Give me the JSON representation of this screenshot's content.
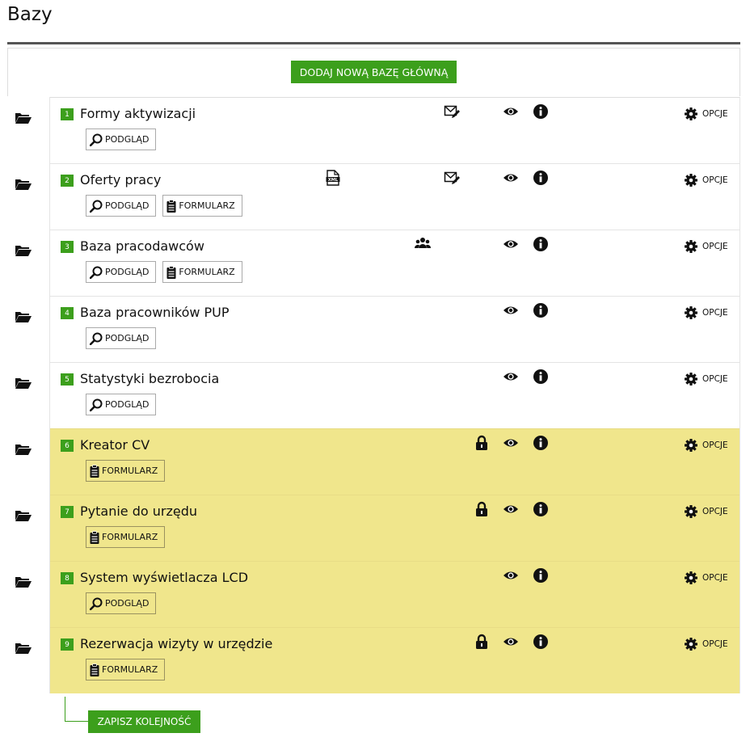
{
  "page": {
    "title": "Bazy"
  },
  "toolbar": {
    "add_label": "DODAJ NOWĄ BAZĘ GŁÓWNĄ"
  },
  "footer": {
    "save_label": "ZAPISZ KOLEJNOŚĆ"
  },
  "labels": {
    "preview": "PODGLĄD",
    "form": "FORMULARZ",
    "options": "OPCJE"
  },
  "colors": {
    "accent": "#3c9f1c",
    "highlight": "#f0e68c"
  },
  "rows": [
    {
      "number": "1",
      "name": "Formy aktywizacji",
      "highlight": false,
      "buttons": [
        "preview"
      ],
      "icons": [
        "envelope-edit-icon",
        "eye-icon",
        "info-icon"
      ]
    },
    {
      "number": "2",
      "name": "Oferty pracy",
      "highlight": false,
      "buttons": [
        "preview",
        "form"
      ],
      "icons": [
        "xml-file-icon",
        "envelope-edit-icon",
        "eye-icon",
        "info-icon"
      ]
    },
    {
      "number": "3",
      "name": "Baza pracodawców",
      "highlight": false,
      "buttons": [
        "preview",
        "form"
      ],
      "icons": [
        "users-icon",
        "eye-icon",
        "info-icon"
      ]
    },
    {
      "number": "4",
      "name": "Baza pracowników PUP",
      "highlight": false,
      "buttons": [
        "preview"
      ],
      "icons": [
        "eye-icon",
        "info-icon"
      ]
    },
    {
      "number": "5",
      "name": "Statystyki bezrobocia",
      "highlight": false,
      "buttons": [
        "preview"
      ],
      "icons": [
        "eye-icon",
        "info-icon"
      ]
    },
    {
      "number": "6",
      "name": "Kreator CV",
      "highlight": true,
      "buttons": [
        "form"
      ],
      "icons": [
        "lock-icon",
        "eye-icon",
        "info-icon"
      ]
    },
    {
      "number": "7",
      "name": "Pytanie do urzędu",
      "highlight": true,
      "buttons": [
        "form"
      ],
      "icons": [
        "lock-icon",
        "eye-icon",
        "info-icon"
      ]
    },
    {
      "number": "8",
      "name": "System wyświetlacza LCD",
      "highlight": true,
      "buttons": [
        "preview"
      ],
      "icons": [
        "eye-icon",
        "info-icon"
      ]
    },
    {
      "number": "9",
      "name": "Rezerwacja wizyty w urzędzie",
      "highlight": true,
      "buttons": [
        "form"
      ],
      "icons": [
        "lock-icon",
        "eye-icon",
        "info-icon"
      ]
    }
  ]
}
